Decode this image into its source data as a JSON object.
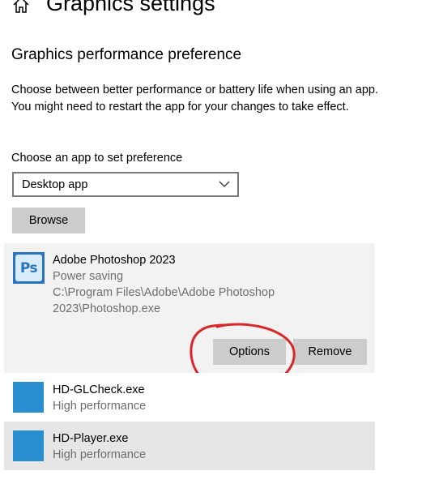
{
  "header": {
    "title": "Graphics settings"
  },
  "section": {
    "title": "Graphics performance preference",
    "description": "Choose between better performance or battery life when using an app. You might need to restart the app for your changes to take effect.",
    "choose_label": "Choose an app to set preference"
  },
  "dropdown": {
    "selected": "Desktop app"
  },
  "buttons": {
    "browse": "Browse",
    "options": "Options",
    "remove": "Remove"
  },
  "apps": [
    {
      "name": "Adobe Photoshop 2023",
      "preference": "Power saving",
      "path": "C:\\Program Files\\Adobe\\Adobe Photoshop 2023\\Photoshop.exe",
      "icon_text": "Ps",
      "icon": "photoshop-icon"
    },
    {
      "name": "HD-GLCheck.exe",
      "preference": "High performance",
      "icon": "app-icon"
    },
    {
      "name": "HD-Player.exe",
      "preference": "High performance",
      "icon": "app-icon"
    }
  ],
  "colors": {
    "button_bg": "#cccccc",
    "selected_card_bg": "#f2f2f2",
    "hover_row_bg": "#e6e6e6",
    "app_icon_blue": "#2a8fd1",
    "secondary_text": "#6e6e6e",
    "annotation_red": "#d9262b"
  }
}
